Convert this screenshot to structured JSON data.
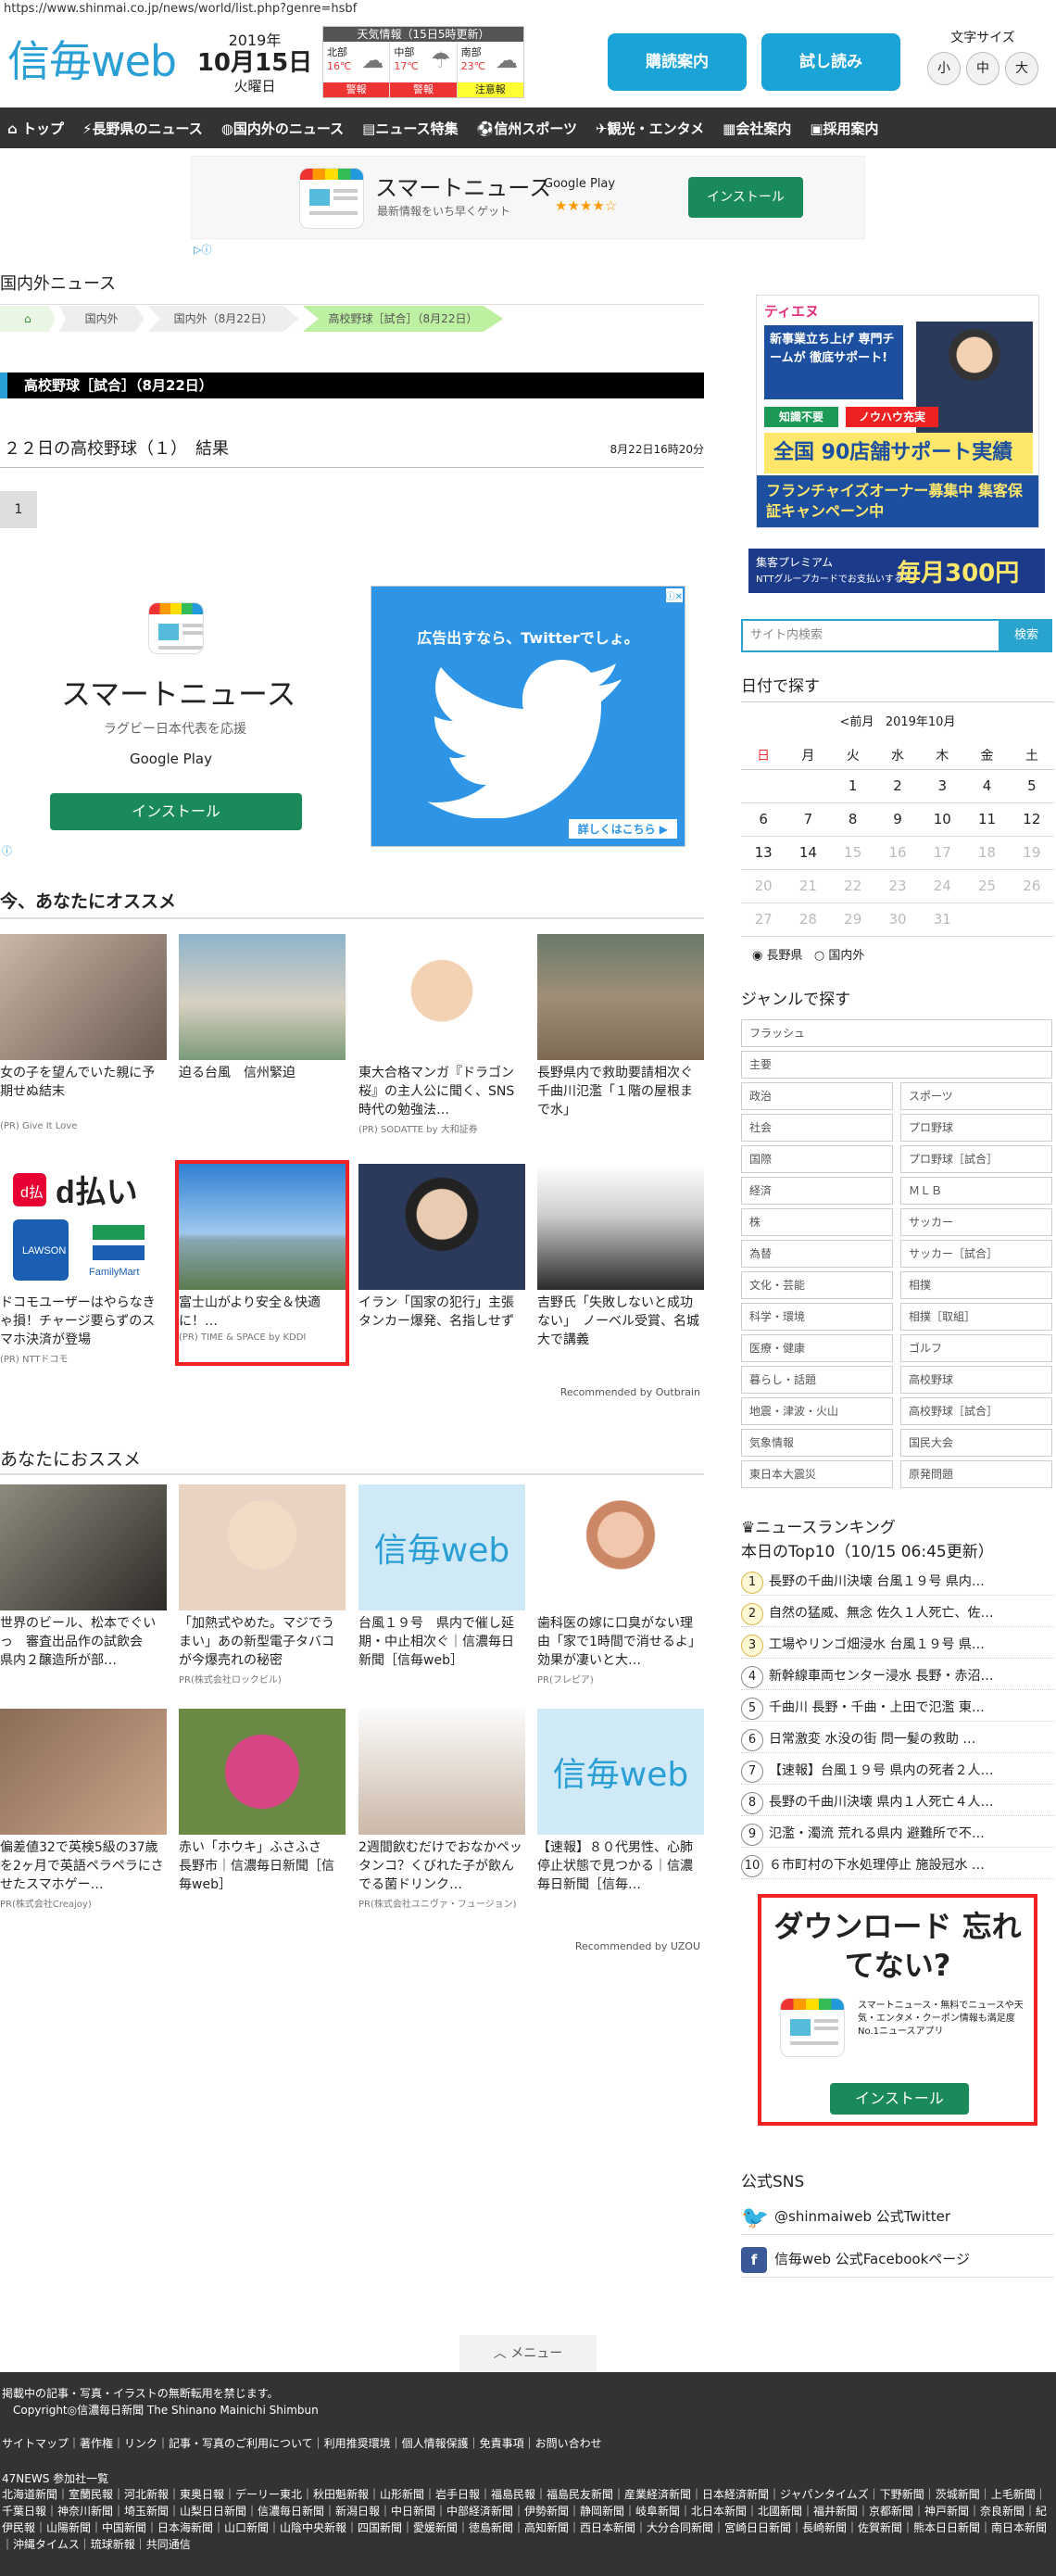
{
  "url": "https://www.shinmai.co.jp/news/world/list.php?genre=hsbf",
  "header": {
    "logo_main": "信毎",
    "logo_web": "web",
    "year": "2019年",
    "month_day": "10月15日",
    "weekday": "火曜日",
    "weather": {
      "title": "天気情報（15日5時更新）",
      "regions": [
        {
          "name": "北部",
          "temp": "16℃",
          "warn": "警報",
          "warn_color": "#e33"
        },
        {
          "name": "中部",
          "temp": "17℃",
          "warn": "警報",
          "warn_color": "#e33"
        },
        {
          "name": "南部",
          "temp": "23℃",
          "warn": "注意報",
          "warn_color": "#ff3"
        }
      ]
    },
    "subscribe_btn": "購読案内",
    "trial_btn": "試し読み",
    "font_size_label": "文字サイズ",
    "font_small": "小",
    "font_medium": "中",
    "font_large": "大"
  },
  "nav": [
    "トップ",
    "長野県のニュース",
    "国内外のニュース",
    "ニュース特集",
    "信州スポーツ",
    "観光・エンタメ",
    "会社案内",
    "採用案内"
  ],
  "ad1": {
    "title": "スマートニュース",
    "sub": "最新情報をいち早くゲット",
    "store": "Google Play",
    "stars": "★★★★☆",
    "install": "インストール"
  },
  "section_heading": "国内外ニュース",
  "breadcrumb": [
    "国内外",
    "国内外（8月22日）",
    "高校野球［試合］（8月22日）"
  ],
  "category_bar": "高校野球［試合］（8月22日）",
  "article": {
    "title": "２２日の高校野球（１）　結果",
    "date": "8月22日16時20分"
  },
  "page_num": "1",
  "ad2": {
    "title": "スマートニュース",
    "sub": "ラグビー日本代表を応援",
    "store": "Google Play",
    "install": "インストール",
    "tw_text": "広告出すなら、Twitterでしょ。",
    "tw_more": "詳しくはこちら ▶"
  },
  "rec1": {
    "heading": "今、あなたにオススメ",
    "items": [
      {
        "cap": "女の子を望んでいた親に予期せぬ結末",
        "src": "(PR) Give It Love"
      },
      {
        "cap": "迫る台風　信州緊迫",
        "src": ""
      },
      {
        "cap": "東大合格マンガ『ドラゴン桜』の主人公に聞く、SNS時代の勉強法…",
        "src": "(PR) SODATTE by 大和証券"
      },
      {
        "cap": "長野県内で救助要請相次ぐ　千曲川氾濫「１階の屋根まで水」",
        "src": ""
      },
      {
        "cap": "ドコモユーザーはやらなきゃ損！チャージ要らずのスマホ決済が登場",
        "src": "(PR) NTTドコモ"
      },
      {
        "cap": "富士山がより安全＆快適に！…",
        "src": "(PR) TIME & SPACE by KDDI"
      },
      {
        "cap": "イラン「国家の犯行」主張　タンカー爆発、名指しせず",
        "src": ""
      },
      {
        "cap": "吉野氏「失敗しないと成功ない」　ノーベル受賞、名城大で講義",
        "src": ""
      }
    ],
    "recommended_by": "Recommended by Outbrain"
  },
  "rec2": {
    "heading": "あなたにおススメ",
    "items": [
      {
        "cap": "世界のビール、松本でぐいっ　審査出品作の試飲会　県内２醸造所が部…",
        "src": ""
      },
      {
        "cap": "「加熱式やめた。マジでうまい」あの新型電子タバコが今爆売れの秘密",
        "src": "PR(株式会社ロックビル)"
      },
      {
        "cap": "台風１９号　県内で催し延期・中止相次ぐ｜信濃毎日新聞［信毎web］",
        "src": ""
      },
      {
        "cap": "歯科医の嫁に口臭がない理由「家で1時間で消せるよ」効果が凄いと大…",
        "src": "PR(フレピア)"
      },
      {
        "cap": "偏差値32で英検5級の37歳を2ヶ月で英語ペラペラにさせたスマホゲー…",
        "src": "PR(株式会社Creajoy)"
      },
      {
        "cap": "赤い「ホウキ」ふさふさ　長野市｜信濃毎日新聞［信毎web］",
        "src": ""
      },
      {
        "cap": "2週間飲むだけでおなかペッタンコ？くびれた子が飲んでる菌ドリンク…",
        "src": "PR(株式会社ユニヴァ・フュージョン)"
      },
      {
        "cap": "【速報】８０代男性、心肺停止状態で見つかる｜信濃毎日新聞［信毎…",
        "src": ""
      }
    ],
    "recommended_by": "Recommended by UZOU",
    "logo_main": "信毎",
    "logo_web": "web"
  },
  "sidebar": {
    "ad1": {
      "brand": "ティエヌ",
      "line1": "新事業立ち上げ 専門チームが 徹底サポート!",
      "p1": "知識不要",
      "p2": "ノウハウ充実",
      "big": "全国 90店舗サポート実績",
      "bottom": "フランチャイズオーナー募集中 集客保証キャンペーン中"
    },
    "ad2": {
      "a": "集客プレミアム",
      "b": "NTTグループカードでお支払いすると",
      "c": "毎月300円"
    },
    "search_placeholder": "サイト内検索",
    "search_btn": "検索",
    "date_heading": "日付で探す",
    "cal_prev": "<前月",
    "cal_month": "2019年10月",
    "cal_days": [
      "日",
      "月",
      "火",
      "水",
      "木",
      "金",
      "土"
    ],
    "cal_rows": [
      [
        "",
        "",
        "1",
        "2",
        "3",
        "4",
        "5"
      ],
      [
        "6",
        "7",
        "8",
        "9",
        "10",
        "11",
        "12"
      ],
      [
        "13",
        "14",
        "15",
        "16",
        "17",
        "18",
        "19"
      ],
      [
        "20",
        "21",
        "22",
        "23",
        "24",
        "25",
        "26"
      ],
      [
        "27",
        "28",
        "29",
        "30",
        "31",
        "",
        ""
      ]
    ],
    "cal_radio1": "長野県",
    "cal_radio2": "国内外",
    "genre_heading": "ジャンルで探す",
    "genres_full": [
      "フラッシュ",
      "主要"
    ],
    "genres": [
      "政治",
      "スポーツ",
      "社会",
      "プロ野球",
      "国際",
      "プロ野球［試合］",
      "経済",
      "ＭＬＢ",
      "株",
      "サッカー",
      "為替",
      "サッカー［試合］",
      "文化・芸能",
      "相撲",
      "科学・環境",
      "相撲［取組］",
      "医療・健康",
      "ゴルフ",
      "暮らし・話題",
      "高校野球",
      "地震・津波・火山",
      "高校野球［試合］",
      "気象情報",
      "国民大会",
      "東日本大震災",
      "原発問題"
    ],
    "rank_heading": "ニュースランキング",
    "rank_sub": "本日のTop10（10/15 06:45更新）",
    "ranks": [
      "長野の千曲川決壊 台風１９号 県内…",
      "自然の猛威、無念 佐久１人死亡、佐…",
      "工場やリンゴ畑浸水 台風１９号 県…",
      "新幹線車両センター浸水 長野・赤沼…",
      "千曲川 長野・千曲・上田で氾濫 東…",
      "日常激変 水没の街 問一髪の救助 …",
      "【速報】台風１９号 県内の死者２人…",
      "長野の千曲川決壊 県内１人死亡４人…",
      "氾濫・濁流 荒れる県内 避難所で不…",
      "６市町村の下水処理停止 施設冠水 …"
    ],
    "ad3": {
      "title": "ダウンロード 忘れてない?",
      "desc": "スマートニュース・無料でニュースや天気・エンタメ・クーポン情報も満足度No.1ニュースアプリ",
      "install": "インストール"
    },
    "sns_heading": "公式SNS",
    "twitter": "@shinmaiweb 公式Twitter",
    "facebook": "信毎web 公式Facebookページ"
  },
  "menu": "メニュー",
  "footer": {
    "copy1": "掲載中の記事・写真・イラストの無断転用を禁じます。",
    "copy2": "Copyright◎信濃毎日新聞 The Shinano Mainichi Shimbun",
    "links": "サイトマップ｜著作権｜リンク｜記事・写真のご利用について｜利用推奨環境｜個人情報保護｜免責事項｜お問い合わせ",
    "partners_title": "47NEWS 参加社一覧",
    "partners": "北海道新聞｜室蘭民報｜河北新報｜東奥日報｜デーリー東北｜秋田魁新報｜山形新聞｜岩手日報｜福島民報｜福島民友新聞｜産業経済新聞｜日本経済新聞｜ジャパンタイムズ｜下野新聞｜茨城新聞｜上毛新聞｜千葉日報｜神奈川新聞｜埼玉新聞｜山梨日日新聞｜信濃毎日新聞｜新潟日報｜中日新聞｜中部経済新聞｜伊勢新聞｜静岡新聞｜岐阜新聞｜北日本新聞｜北國新聞｜福井新聞｜京都新聞｜神戸新聞｜奈良新聞｜紀伊民報｜山陽新聞｜中国新聞｜日本海新聞｜山口新聞｜山陰中央新報｜四国新聞｜愛媛新聞｜徳島新聞｜高知新聞｜西日本新聞｜大分合同新聞｜宮崎日日新聞｜長崎新聞｜佐賀新聞｜熊本日日新聞｜南日本新聞｜沖縄タイムス｜琉球新報｜共同通信"
  }
}
